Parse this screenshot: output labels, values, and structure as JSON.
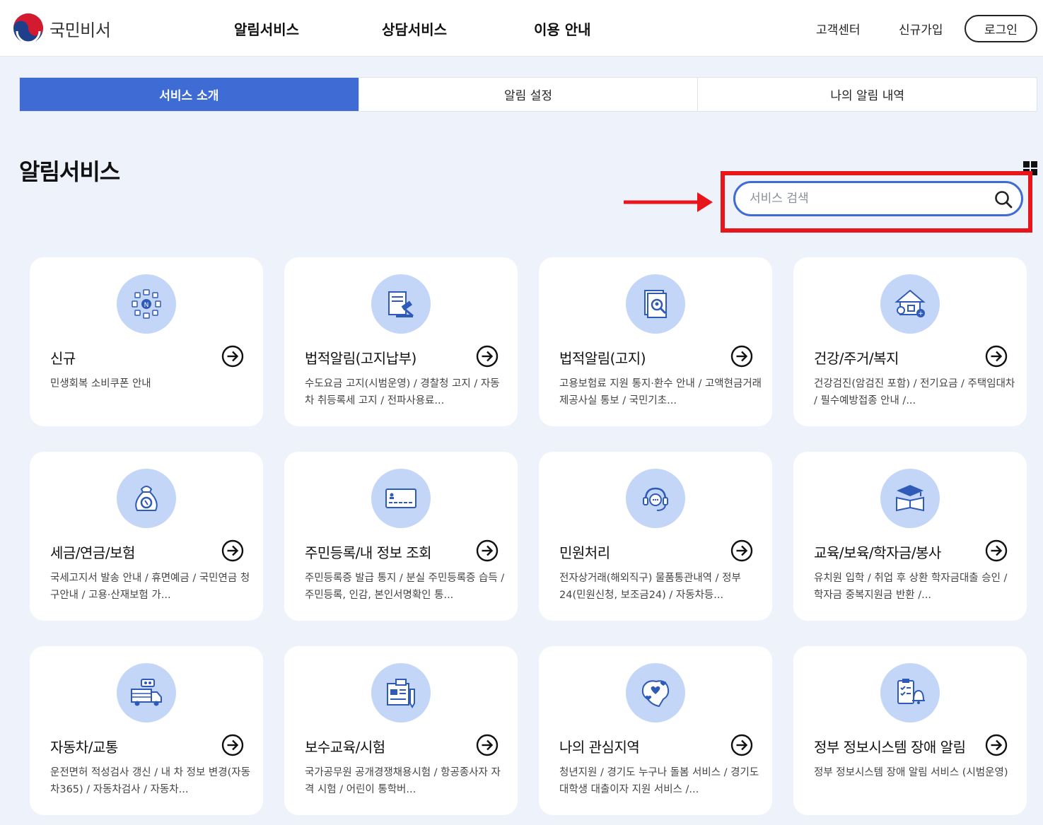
{
  "header": {
    "logo_text": "국민비서",
    "nav": [
      "알림서비스",
      "상담서비스",
      "이용 안내"
    ],
    "util": [
      "고객센터",
      "신규가입"
    ],
    "login_label": "로그인"
  },
  "tabs": [
    {
      "label": "서비스 소개",
      "active": true
    },
    {
      "label": "알림 설정",
      "active": false
    },
    {
      "label": "나의 알림 내역",
      "active": false
    }
  ],
  "page_title": "알림서비스",
  "search": {
    "placeholder": "서비스 검색"
  },
  "colors": {
    "accent": "#3f6cd4",
    "icon_bg": "#c4d6f8",
    "highlight": "#e8161b",
    "page_bg": "#eef2fa"
  },
  "cards": [
    {
      "title": "신규",
      "desc": "민생회복 소비쿠폰 안내",
      "icon": "new-service-icon"
    },
    {
      "title": "법적알림(고지납부)",
      "desc": "수도요금 고지(시범운영) / 경찰청 고지 / 자동차 취등록세 고지 / 전파사용료...",
      "icon": "legal-document-gavel-icon"
    },
    {
      "title": "법적알림(고지)",
      "desc": "고용보험료 지원 통지·환수 안내 / 고액현금거래 제공사실 통보 / 국민기초...",
      "icon": "document-search-icon"
    },
    {
      "title": "건강/주거/복지",
      "desc": "건강검진(암검진 포함) / 전기요금 / 주택임대차 / 필수예방접종 안내 /...",
      "icon": "house-health-icon"
    },
    {
      "title": "세금/연금/보험",
      "desc": "국세고지서 발송 안내 / 휴면예금 / 국민연금 청구안내 / 고용·산재보험 가...",
      "icon": "money-bag-icon"
    },
    {
      "title": "주민등록/내 정보 조회",
      "desc": "주민등록증 발급 통지 / 분실 주민등록증 습득 / 주민등록, 인감, 본인서명확인 통...",
      "icon": "id-card-icon"
    },
    {
      "title": "민원처리",
      "desc": "전자상거래(해외직구) 물품통관내역 / 정부24(민원신청, 보조금24) / 자동차등...",
      "icon": "headset-icon"
    },
    {
      "title": "교육/보육/학자금/봉사",
      "desc": "유치원 입학 / 취업 후 상환 학자금대출 승인 / 학자금 중복지원금 반환 /...",
      "icon": "graduation-book-icon"
    },
    {
      "title": "자동차/교통",
      "desc": "운전면허 적성검사 갱신 / 내 차 정보 변경(자동차365) / 자동차검사 / 자동차...",
      "icon": "truck-icon"
    },
    {
      "title": "보수교육/시험",
      "desc": "국가공무원 공개경쟁채용시험 / 항공종사자 자격 시험 / 어린이 통학버...",
      "icon": "exam-clipboard-icon"
    },
    {
      "title": "나의 관심지역",
      "desc": "청년지원 / 경기도 누구나 돌봄 서비스 / 경기도 대학생 대출이자 지원 서비스 /...",
      "icon": "map-heart-icon"
    },
    {
      "title": "정부 정보시스템 장애 알림",
      "desc": "정부 정보시스템 장애 알림 서비스 (시범운영)",
      "icon": "checklist-bell-icon"
    }
  ]
}
